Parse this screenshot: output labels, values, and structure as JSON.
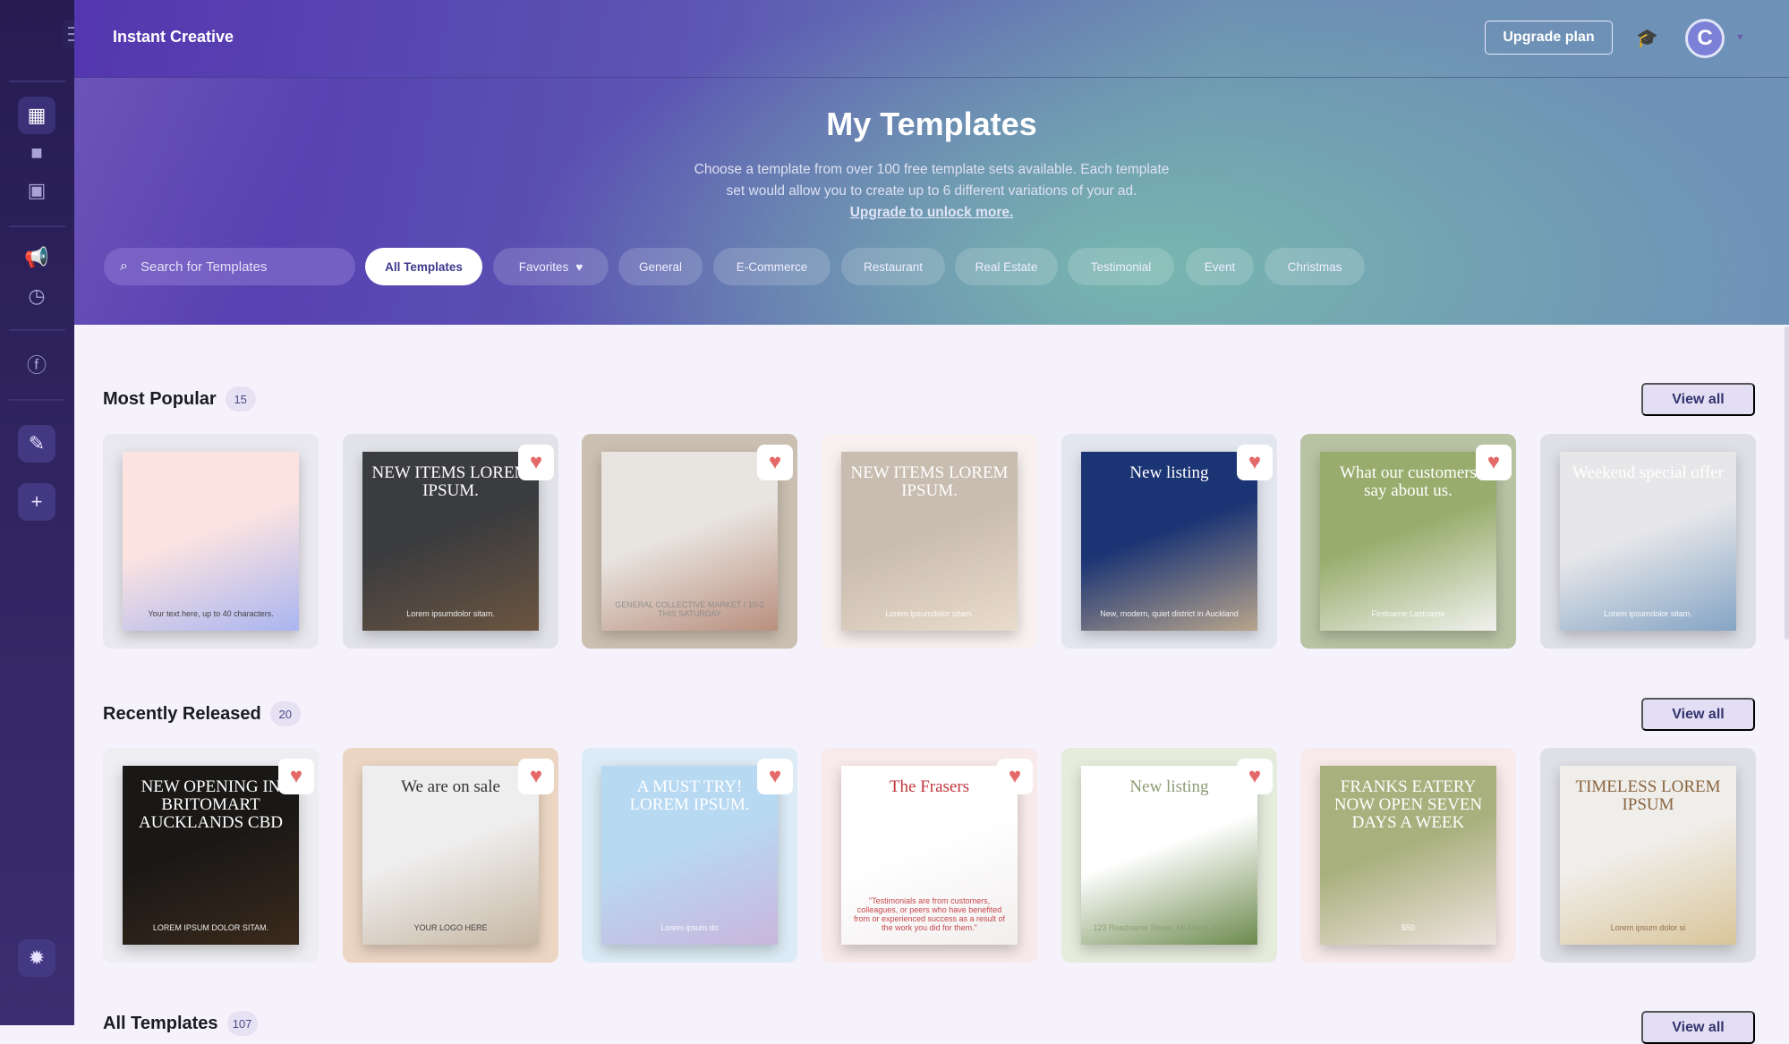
{
  "app": {
    "title": "Instant Creative",
    "upgrade_label": "Upgrade plan",
    "avatar_initial": "C"
  },
  "sidebar": {
    "items": [
      {
        "name": "templates",
        "icon": "grid-icon",
        "glyph": "▦",
        "active": true
      },
      {
        "name": "folders",
        "icon": "folder-icon",
        "glyph": "■"
      },
      {
        "name": "images",
        "icon": "image-icon",
        "glyph": "▣"
      },
      {
        "name": "campaigns",
        "icon": "megaphone-icon",
        "glyph": "📢"
      },
      {
        "name": "history",
        "icon": "clock-icon",
        "glyph": "◷"
      },
      {
        "name": "facebook",
        "icon": "facebook-icon",
        "glyph": "ⓕ"
      },
      {
        "name": "magic",
        "icon": "magic-wand-icon",
        "glyph": "✎",
        "btn": true
      },
      {
        "name": "add",
        "icon": "plus-icon",
        "glyph": "+",
        "btn": true
      },
      {
        "name": "bug-report",
        "icon": "bug-icon",
        "glyph": "✹",
        "btn": true
      }
    ]
  },
  "hero": {
    "title": "My Templates",
    "desc_line1": "Choose a template from over 100 free template sets available. Each template",
    "desc_line2": "set would allow you to create up to 6 different variations of your ad.",
    "link": "Upgrade to unlock more.",
    "search_placeholder": "Search for Templates",
    "filters": [
      "All Templates",
      "Favorites",
      "General",
      "E-Commerce",
      "Restaurant",
      "Real Estate",
      "Testimonial",
      "Event",
      "Christmas"
    ],
    "active_filter": "All Templates"
  },
  "sections": [
    {
      "title": "Most Popular",
      "count": "15",
      "view_all": "View all",
      "cards": [
        {
          "bg": "#e9e8ee",
          "p1": "#fbe3e1",
          "p2": "#aab5f0",
          "fg": "#333",
          "head": "",
          "sub": "Your text here, up to 40 characters.",
          "fav": false
        },
        {
          "bg": "#e2e3e9",
          "p1": "#3b3c3f",
          "p2": "#6b5540",
          "fg": "#fff",
          "head": "NEW ITEMS LOREM IPSUM.",
          "sub": "Lorem ipsumdolor sitam.",
          "fav": true
        },
        {
          "bg": "#cbbfb1",
          "p1": "#e8e4df",
          "p2": "#b98f7e",
          "fg": "#8a8a8a",
          "head": "",
          "sub": "GENERAL COLLECTIVE MARKET / 10-2 THIS SATURDAY",
          "fav": true
        },
        {
          "bg": "#f8f1ef",
          "p1": "#c9bcb0",
          "p2": "#e9dccb",
          "fg": "#fff",
          "head": "NEW ITEMS LOREM IPSUM.",
          "sub": "Lorem ipsumdolor sitam.",
          "fav": false
        },
        {
          "bg": "#e3e6ef",
          "p1": "#1b3474",
          "p2": "#b8a58c",
          "fg": "#fff",
          "head": "New listing",
          "sub": "New, modern, quiet district in Auckland",
          "fav": true
        },
        {
          "bg": "#b7c3a3",
          "p1": "#98ad6d",
          "p2": "#f1f1ee",
          "fg": "#fff",
          "head": "What our customers say about us.",
          "sub": "Firstname Lastname",
          "fav": true
        },
        {
          "bg": "#dfe0e7",
          "p1": "#e7e7ea",
          "p2": "#84a4c4",
          "fg": "#fff",
          "head": "Weekend special offer",
          "sub": "Lorem ipsumdolor sitam.",
          "fav": false
        }
      ]
    },
    {
      "title": "Recently Released",
      "count": "20",
      "view_all": "View all",
      "cards": [
        {
          "bg": "#eeedf1",
          "p1": "#1a1816",
          "p2": "#3b2a1c",
          "fg": "#fff",
          "head": "NEW OPENING IN BRITOMART AUCKLANDS CBD",
          "sub": "LOREM IPSUM DOLOR SITAM.",
          "fav": true
        },
        {
          "bg": "#ecd6c3",
          "p1": "#efeeee",
          "p2": "#c6b7a3",
          "fg": "#333",
          "head": "We are on sale",
          "sub": "YOUR LOGO HERE",
          "fav": true
        },
        {
          "bg": "#dcebf6",
          "p1": "#b8d9f2",
          "p2": "#c9b6dd",
          "fg": "#fff",
          "head": "A MUST TRY! LOREM IPSUM.",
          "sub": "Lorem ipsum do",
          "fav": true
        },
        {
          "bg": "#f8e9ea",
          "p1": "#ffffff",
          "p2": "#f2eeee",
          "fg": "#c0353b",
          "head": "The Frasers",
          "sub": "\"Testimonials are from customers, colleagues, or peers who have benefited from or experienced success as a result of the work you did for them.\"",
          "fav": true
        },
        {
          "bg": "#e6ecdc",
          "p1": "#ffffff",
          "p2": "#6c8a4d",
          "fg": "#8e9a73",
          "head": "New listing",
          "sub": "123 Roadname Street, Mt Albert, Auckland",
          "fav": true
        },
        {
          "bg": "#f8eaea",
          "p1": "#a8b07d",
          "p2": "#efe3df",
          "fg": "#fff",
          "head": "FRANKS EATERY NOW OPEN SEVEN DAYS A WEEK",
          "sub": "$50",
          "fav": false
        },
        {
          "bg": "#dfe0e7",
          "p1": "#f0eeea",
          "p2": "#d9c59a",
          "fg": "#8a6540",
          "head": "TIMELESS LOREM IPSUM",
          "sub": "Lorem ipsum dolor si",
          "fav": false
        }
      ]
    },
    {
      "title": "All Templates",
      "count": "107",
      "view_all": "View all",
      "cards": []
    }
  ],
  "colors": {
    "accent": "#5436b0",
    "heart": "#e46a6a",
    "sidebar": "#2b2159"
  }
}
